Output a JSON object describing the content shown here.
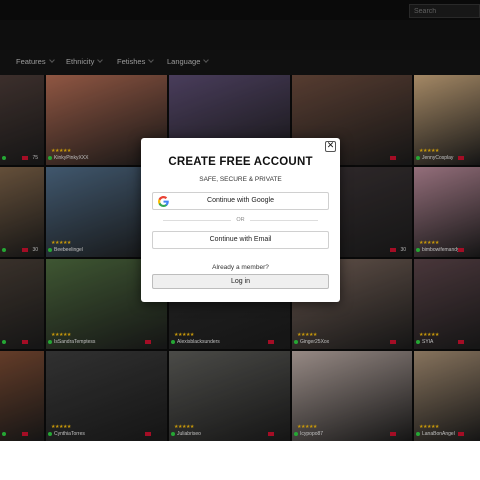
{
  "header": {
    "search_placeholder": "Search"
  },
  "nav": {
    "items": [
      {
        "label": "Features"
      },
      {
        "label": "Ethnicity"
      },
      {
        "label": "Fetishes"
      },
      {
        "label": "Language"
      }
    ]
  },
  "tiles": [
    {
      "name": "",
      "count": "75",
      "color": "#4a3a36"
    },
    {
      "name": "KinkyPinkyXXX",
      "count": "",
      "color": "#b06a52"
    },
    {
      "name": "",
      "count": "",
      "color": "#5a4b70"
    },
    {
      "name": "",
      "count": "",
      "color": "#6a4a3c"
    },
    {
      "name": "JennyCosplay",
      "count": "",
      "color": "#c9a77c"
    },
    {
      "name": "",
      "count": "30",
      "color": "#7b6147"
    },
    {
      "name": "Beebeelingel",
      "count": "",
      "color": "#4f6b86"
    },
    {
      "name": "",
      "count": "",
      "color": "#2f2c35"
    },
    {
      "name": "",
      "count": "30",
      "color": "#3c3436"
    },
    {
      "name": "bimbowifemandy",
      "count": "",
      "color": "#b58796"
    },
    {
      "name": "",
      "count": "",
      "color": "#463c34"
    },
    {
      "name": "IsSandraTemptess",
      "count": "",
      "color": "#4d6a3e"
    },
    {
      "name": "Alexisblacksunders",
      "count": "",
      "color": "#2b2b2b"
    },
    {
      "name": "Ginger25Xox",
      "count": "",
      "color": "#78645a"
    },
    {
      "name": "SYIA",
      "count": "",
      "color": "#5a4348"
    },
    {
      "name": "",
      "count": "",
      "color": "#7a4a32"
    },
    {
      "name": "CynthiaTorres",
      "count": "",
      "color": "#3c3c3c"
    },
    {
      "name": "Juliabriseo",
      "count": "",
      "color": "#5c5c58"
    },
    {
      "name": "Icypopo87",
      "count": "",
      "color": "#b8a8a2"
    },
    {
      "name": "LanaBonAngel",
      "count": "",
      "color": "#a58d72"
    }
  ],
  "modal": {
    "title": "CREATE FREE ACCOUNT",
    "subtitle": "SAFE, SECURE & PRIVATE",
    "google_label": "Continue with Google",
    "or_label": "OR",
    "email_label": "Continue with Email",
    "already_label": "Already a member?",
    "login_label": "Log in",
    "close_symbol": "✕"
  }
}
